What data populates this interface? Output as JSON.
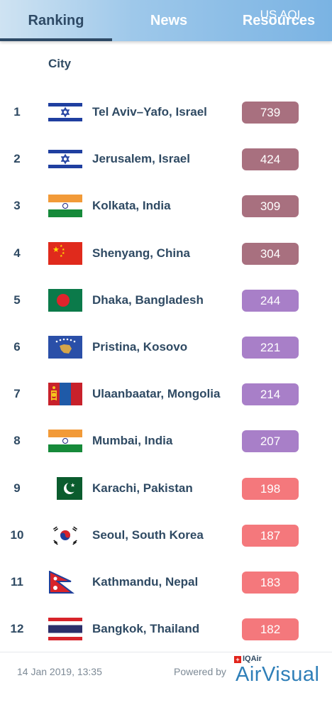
{
  "tabs": [
    {
      "label": "Ranking",
      "active": true
    },
    {
      "label": "News",
      "active": false
    },
    {
      "label": "Resources",
      "active": false
    }
  ],
  "columns": {
    "city": "City",
    "aqi": "US AQI"
  },
  "colors": {
    "maroon": "#a8707f",
    "purple": "#a87fc8",
    "red": "#f4787c",
    "tab_active": "#2e4a66"
  },
  "rows": [
    {
      "rank": "1",
      "city": "Tel Aviv–Yafo, Israel",
      "aqi": "739",
      "flag": "israel-flag",
      "color": "#a8707f"
    },
    {
      "rank": "2",
      "city": "Jerusalem, Israel",
      "aqi": "424",
      "flag": "israel-flag",
      "color": "#a8707f"
    },
    {
      "rank": "3",
      "city": "Kolkata, India",
      "aqi": "309",
      "flag": "india-flag",
      "color": "#a8707f"
    },
    {
      "rank": "4",
      "city": "Shenyang, China",
      "aqi": "304",
      "flag": "china-flag",
      "color": "#a8707f"
    },
    {
      "rank": "5",
      "city": "Dhaka, Bangladesh",
      "aqi": "244",
      "flag": "bangladesh-flag",
      "color": "#a87fc8"
    },
    {
      "rank": "6",
      "city": "Pristina, Kosovo",
      "aqi": "221",
      "flag": "kosovo-flag",
      "color": "#a87fc8"
    },
    {
      "rank": "7",
      "city": "Ulaanbaatar, Mongolia",
      "aqi": "214",
      "flag": "mongolia-flag",
      "color": "#a87fc8"
    },
    {
      "rank": "8",
      "city": "Mumbai, India",
      "aqi": "207",
      "flag": "india-flag",
      "color": "#a87fc8"
    },
    {
      "rank": "9",
      "city": "Karachi, Pakistan",
      "aqi": "198",
      "flag": "pakistan-flag",
      "color": "#f4787c"
    },
    {
      "rank": "10",
      "city": "Seoul, South Korea",
      "aqi": "187",
      "flag": "south-korea-flag",
      "color": "#f4787c"
    },
    {
      "rank": "11",
      "city": "Kathmandu, Nepal",
      "aqi": "183",
      "flag": "nepal-flag",
      "color": "#f4787c"
    },
    {
      "rank": "12",
      "city": "Bangkok, Thailand",
      "aqi": "182",
      "flag": "thailand-flag",
      "color": "#f4787c"
    }
  ],
  "footer": {
    "timestamp": "14 Jan 2019, 13:35",
    "powered_by": "Powered by",
    "brand_small": "IQAir",
    "brand_big": "AirVisual"
  }
}
